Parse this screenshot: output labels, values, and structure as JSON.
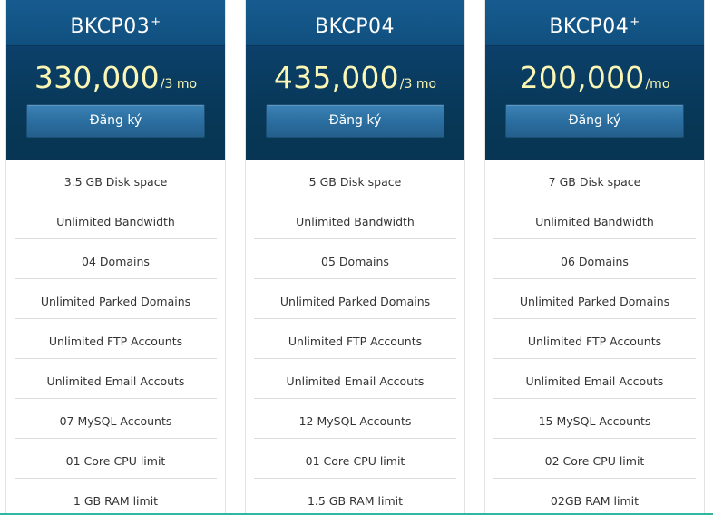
{
  "plans": [
    {
      "name": "BKCP03",
      "name_sup": "+",
      "price": "330,000",
      "period": "/3 mo",
      "button": "Đăng ký",
      "features": [
        "3.5 GB Disk space",
        "Unlimited Bandwidth",
        "04 Domains",
        "Unlimited Parked Domains",
        "Unlimited FTP Accounts",
        "Unlimited Email Accouts",
        "07 MySQL Accounts",
        "01 Core CPU limit",
        "1 GB RAM limit"
      ]
    },
    {
      "name": "BKCP04",
      "name_sup": "",
      "price": "435,000",
      "period": "/3 mo",
      "button": "Đăng ký",
      "features": [
        "5 GB Disk space",
        "Unlimited Bandwidth",
        "05 Domains",
        "Unlimited Parked Domains",
        "Unlimited FTP Accounts",
        "Unlimited Email Accouts",
        "12 MySQL Accounts",
        "01 Core CPU limit",
        "1.5 GB RAM limit"
      ]
    },
    {
      "name": "BKCP04",
      "name_sup": "+",
      "price": "200,000",
      "period": "/mo",
      "button": "Đăng ký",
      "features": [
        "7 GB Disk space",
        "Unlimited Bandwidth",
        "06 Domains",
        "Unlimited Parked Domains",
        "Unlimited FTP Accounts",
        "Unlimited Email Accouts",
        "15 MySQL Accounts",
        "02 Core CPU limit",
        "02GB RAM limit"
      ]
    }
  ],
  "colors": {
    "header_bg": "#0b3f68",
    "price_text": "#fbf6b3",
    "button_bg": "#2a6d9f",
    "divider": "#dcdcdc",
    "bottom_accent": "#2fb7a0"
  }
}
